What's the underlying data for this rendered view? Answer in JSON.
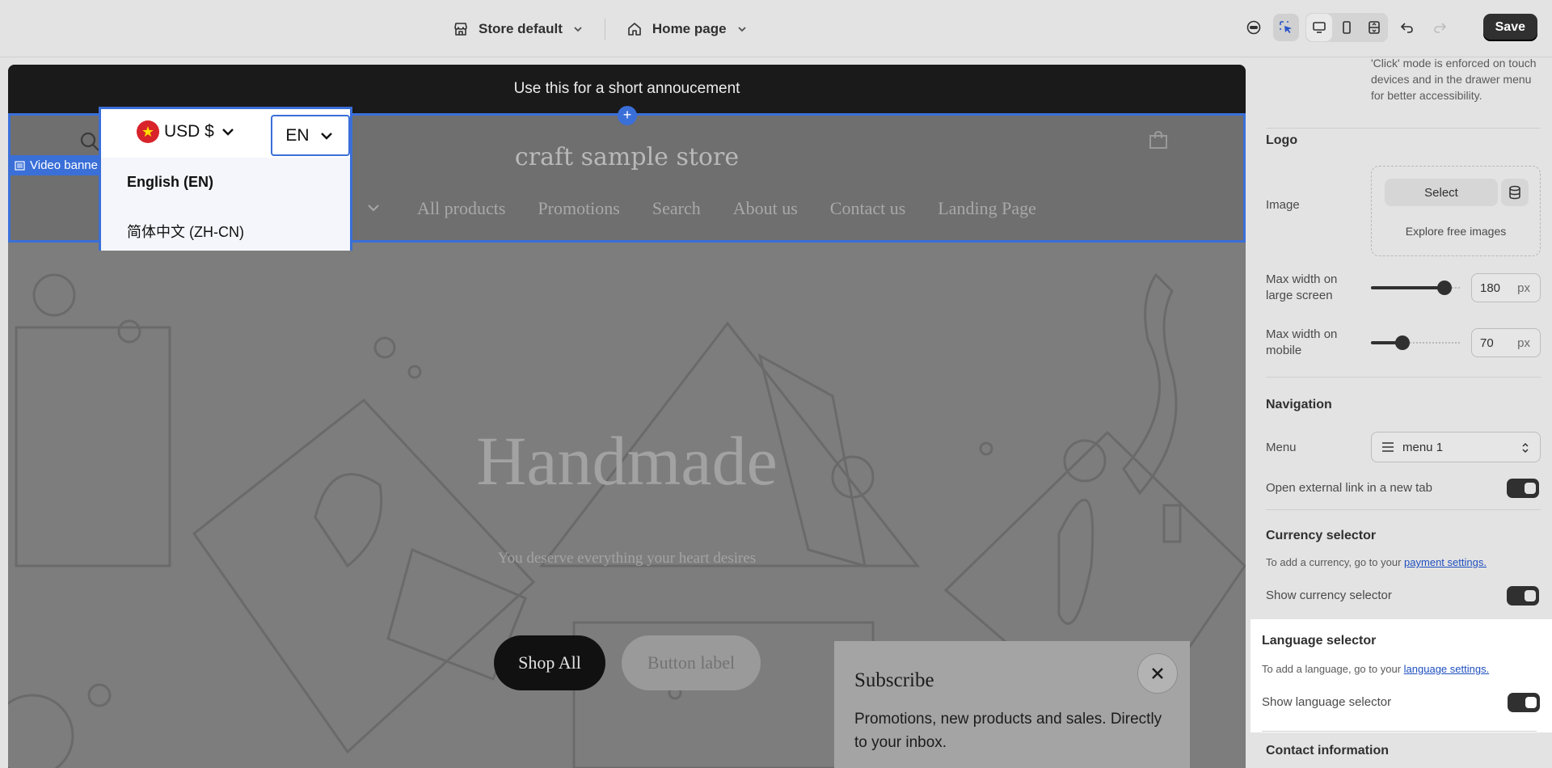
{
  "topbar": {
    "theme_label": "Store default",
    "page_label": "Home page",
    "save_label": "Save"
  },
  "preview": {
    "announcement": "Use this for a short annoucement",
    "section_tag": "Video banner",
    "store_name": "craft sample store",
    "nav_items": [
      "All products",
      "Promotions",
      "Search",
      "About us",
      "Contact us",
      "Landing Page"
    ],
    "currency": "USD $",
    "language_code": "EN",
    "language_options": [
      "English (EN)",
      "简体中文 (ZH-CN)"
    ],
    "hero_title": "Handmade",
    "hero_subtitle": "You deserve everything your heart desires",
    "primary_button": "Shop All",
    "secondary_button": "Button label",
    "subscribe": {
      "title": "Subscribe",
      "text": "Promotions, new products and sales. Directly to your inbox."
    }
  },
  "panel": {
    "click_note": "'Click' mode is enforced on touch devices and in the drawer menu for better accessibility.",
    "logo_heading": "Logo",
    "image_label": "Image",
    "select_label": "Select",
    "explore_label": "Explore free images",
    "max_large_label": "Max width on large screen",
    "max_large_value": "180",
    "max_mobile_label": "Max width on mobile",
    "max_mobile_value": "70",
    "unit": "px",
    "nav_heading": "Navigation",
    "menu_label": "Menu",
    "menu_value": "menu 1",
    "external_link_label": "Open external link in a new tab",
    "currency_heading": "Currency selector",
    "currency_note_prefix": "To add a currency, go to your",
    "currency_note_link": "payment settings.",
    "show_currency_label": "Show currency selector",
    "language_heading": "Language selector",
    "language_note_prefix": "To add a language, go to your",
    "language_note_link": "language settings.",
    "show_language_label": "Show language selector",
    "contact_heading": "Contact information"
  }
}
